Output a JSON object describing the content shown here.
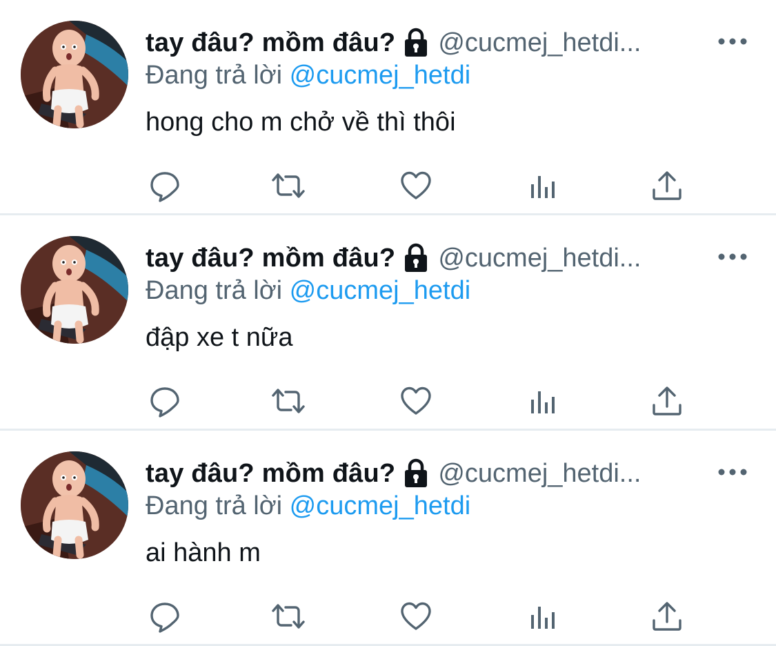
{
  "tweets": [
    {
      "display_name": "tay đâu? mồm đâu?",
      "handle": "@cucmej_hetdi...",
      "reply_prefix": "Đang trả lời ",
      "reply_mention": "@cucmej_hetdi",
      "text": "hong cho m chở về thì thôi"
    },
    {
      "display_name": "tay đâu? mồm đâu?",
      "handle": "@cucmej_hetdi...",
      "reply_prefix": "Đang trả lời ",
      "reply_mention": "@cucmej_hetdi",
      "text": "đập xe t nữa"
    },
    {
      "display_name": "tay đâu? mồm đâu?",
      "handle": "@cucmej_hetdi...",
      "reply_prefix": "Đang trả lời ",
      "reply_mention": "@cucmej_hetdi",
      "text": "ai hành m"
    }
  ],
  "icons": {
    "protected": "lock-icon",
    "more": "more-icon",
    "reply": "reply-icon",
    "retweet": "retweet-icon",
    "like": "heart-icon",
    "views": "analytics-icon",
    "share": "share-icon"
  },
  "colors": {
    "text": "#0f1419",
    "secondary": "#536471",
    "mention": "#1d9bf0",
    "icon": "#536471",
    "divider": "#e6ecf0"
  }
}
